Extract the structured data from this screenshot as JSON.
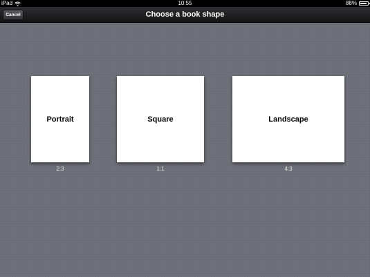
{
  "status_bar": {
    "device": "iPad",
    "time": "10:55",
    "battery": "88%",
    "battery_level": 0.88
  },
  "nav_bar": {
    "title": "Choose a book shape",
    "cancel_label": "Cancel"
  },
  "shapes": [
    {
      "label": "Portrait",
      "ratio": "2:3"
    },
    {
      "label": "Square",
      "ratio": "1:1"
    },
    {
      "label": "Landscape",
      "ratio": "4:3"
    }
  ]
}
